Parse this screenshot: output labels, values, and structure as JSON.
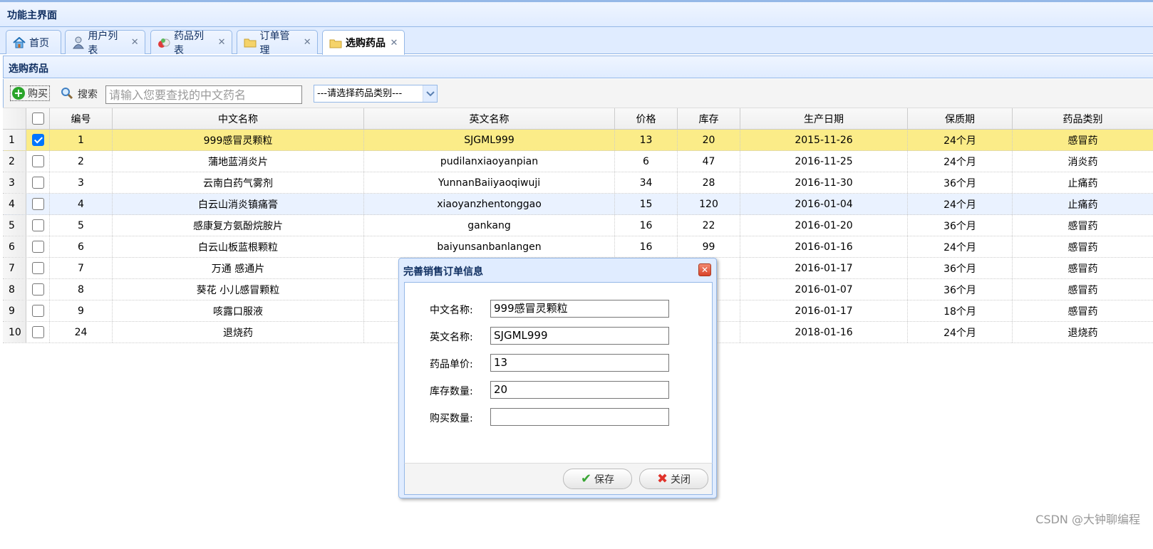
{
  "app": {
    "title": "功能主界面"
  },
  "tabs": [
    {
      "label": "首页",
      "icon": "home-icon",
      "closable": false
    },
    {
      "label": "用户列表",
      "icon": "users-icon",
      "closable": true
    },
    {
      "label": "药品列表",
      "icon": "pills-icon",
      "closable": true
    },
    {
      "label": "订单管理",
      "icon": "folder-icon",
      "closable": true
    },
    {
      "label": "选购药品",
      "icon": "folder-icon",
      "closable": true,
      "active": true
    }
  ],
  "panel": {
    "title": "选购药品"
  },
  "toolbar": {
    "buy_label": "购买",
    "search_label": "搜索",
    "search_placeholder": "请输入您要查找的中文药名",
    "type_select_value": "---请选择药品类别---"
  },
  "table": {
    "columns": [
      "编号",
      "中文名称",
      "英文名称",
      "价格",
      "库存",
      "生产日期",
      "保质期",
      "药品类别"
    ],
    "rows": [
      {
        "rownum": "1",
        "checked": true,
        "id": "1",
        "cn": "999感冒灵颗粒",
        "en": "SJGML999",
        "price": "13",
        "stock": "20",
        "date": "2015-11-26",
        "shelf": "24个月",
        "type": "感冒药"
      },
      {
        "rownum": "2",
        "checked": false,
        "id": "2",
        "cn": "蒲地蓝消炎片",
        "en": "pudilanxiaoyanpian",
        "price": "6",
        "stock": "47",
        "date": "2016-11-25",
        "shelf": "24个月",
        "type": "消炎药"
      },
      {
        "rownum": "3",
        "checked": false,
        "id": "3",
        "cn": "云南白药气雾剂",
        "en": "YunnanBaiiyaoqiwuji",
        "price": "34",
        "stock": "28",
        "date": "2016-11-30",
        "shelf": "36个月",
        "type": "止痛药"
      },
      {
        "rownum": "4",
        "checked": false,
        "id": "4",
        "cn": "白云山消炎镇痛膏",
        "en": "xiaoyanzhentonggao",
        "price": "15",
        "stock": "120",
        "date": "2016-01-04",
        "shelf": "24个月",
        "type": "止痛药"
      },
      {
        "rownum": "5",
        "checked": false,
        "id": "5",
        "cn": "感康复方氨酚烷胺片",
        "en": "gankang",
        "price": "16",
        "stock": "22",
        "date": "2016-01-20",
        "shelf": "36个月",
        "type": "感冒药"
      },
      {
        "rownum": "6",
        "checked": false,
        "id": "6",
        "cn": "白云山板蓝根颗粒",
        "en": "baiyunsanbanlangen",
        "price": "16",
        "stock": "99",
        "date": "2016-01-16",
        "shelf": "24个月",
        "type": "感冒药"
      },
      {
        "rownum": "7",
        "checked": false,
        "id": "7",
        "cn": "万通 感通片",
        "en": "",
        "price": "",
        "stock": "",
        "date": "2016-01-17",
        "shelf": "36个月",
        "type": "感冒药"
      },
      {
        "rownum": "8",
        "checked": false,
        "id": "8",
        "cn": "葵花 小儿感冒颗粒",
        "en": "",
        "price": "",
        "stock": "",
        "date": "2016-01-07",
        "shelf": "36个月",
        "type": "感冒药"
      },
      {
        "rownum": "9",
        "checked": false,
        "id": "9",
        "cn": "咳露口服液",
        "en": "",
        "price": "",
        "stock": "",
        "date": "2016-01-17",
        "shelf": "18个月",
        "type": "感冒药"
      },
      {
        "rownum": "10",
        "checked": false,
        "id": "24",
        "cn": "退烧药",
        "en": "",
        "price": "",
        "stock": "",
        "date": "2018-01-16",
        "shelf": "24个月",
        "type": "退烧药"
      }
    ]
  },
  "dialog": {
    "title": "完善销售订单信息",
    "fields": [
      {
        "label": "中文名称:",
        "value": "999感冒灵颗粒"
      },
      {
        "label": "英文名称:",
        "value": "SJGML999"
      },
      {
        "label": "药品单价:",
        "value": "13"
      },
      {
        "label": "库存数量:",
        "value": "20"
      },
      {
        "label": "购买数量:",
        "value": ""
      }
    ],
    "save_label": "保存",
    "close_label": "关闭"
  },
  "watermark": "CSDN @大钟聊编程",
  "colors": {
    "border": "#95B8E7",
    "header_bg": "#E0ECFF",
    "selected_row": "#FBEC88",
    "hover_row": "#EAF2FF"
  }
}
